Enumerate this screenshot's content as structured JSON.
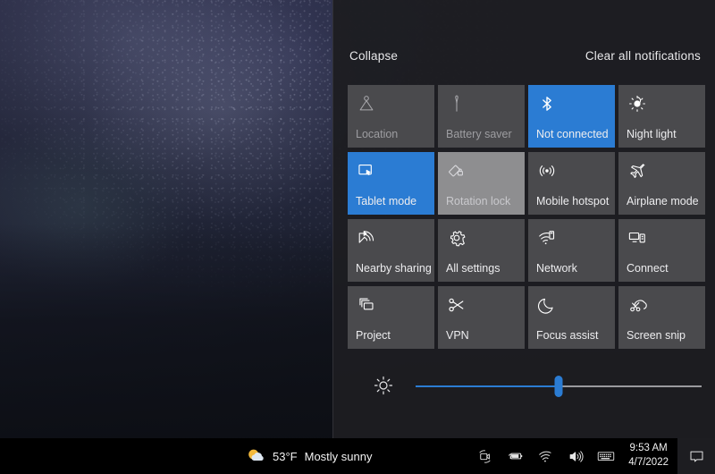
{
  "action_center": {
    "collapse_label": "Collapse",
    "clear_all_label": "Clear all notifications",
    "accent_color": "#2b7cd3",
    "panel_color": "#1d1d21",
    "tile_color": "#4a4a4d",
    "tiles": [
      {
        "label": "Location",
        "icon": "location-icon",
        "state": "dim"
      },
      {
        "label": "Battery saver",
        "icon": "battery-saver-icon",
        "state": "dim"
      },
      {
        "label": "Not connected",
        "icon": "bluetooth-icon",
        "state": "active"
      },
      {
        "label": "Night light",
        "icon": "night-light-icon",
        "state": "normal"
      },
      {
        "label": "Tablet mode",
        "icon": "tablet-mode-icon",
        "state": "active"
      },
      {
        "label": "Rotation lock",
        "icon": "rotation-lock-icon",
        "state": "disabled"
      },
      {
        "label": "Mobile hotspot",
        "icon": "mobile-hotspot-icon",
        "state": "normal"
      },
      {
        "label": "Airplane mode",
        "icon": "airplane-mode-icon",
        "state": "normal"
      },
      {
        "label": "Nearby sharing",
        "icon": "nearby-sharing-icon",
        "state": "normal"
      },
      {
        "label": "All settings",
        "icon": "gear-icon",
        "state": "normal"
      },
      {
        "label": "Network",
        "icon": "network-icon",
        "state": "normal"
      },
      {
        "label": "Connect",
        "icon": "connect-icon",
        "state": "normal"
      },
      {
        "label": "Project",
        "icon": "project-icon",
        "state": "normal"
      },
      {
        "label": "VPN",
        "icon": "vpn-icon",
        "state": "normal"
      },
      {
        "label": "Focus assist",
        "icon": "moon-icon",
        "state": "normal"
      },
      {
        "label": "Screen snip",
        "icon": "screen-snip-icon",
        "state": "normal"
      }
    ],
    "brightness": {
      "icon": "brightness-icon",
      "value_percent": 50
    }
  },
  "taskbar": {
    "weather": {
      "icon": "sun-behind-cloud-icon",
      "temperature": "53°F",
      "condition": "Mostly sunny"
    },
    "tray_icons": [
      {
        "name": "meet-now-icon"
      },
      {
        "name": "battery-icon"
      },
      {
        "name": "wifi-icon"
      },
      {
        "name": "volume-icon"
      },
      {
        "name": "touch-keyboard-icon"
      }
    ],
    "clock": {
      "time": "9:53 AM",
      "date": "4/7/2022"
    },
    "action_center_button": {
      "icon": "notification-icon"
    }
  }
}
